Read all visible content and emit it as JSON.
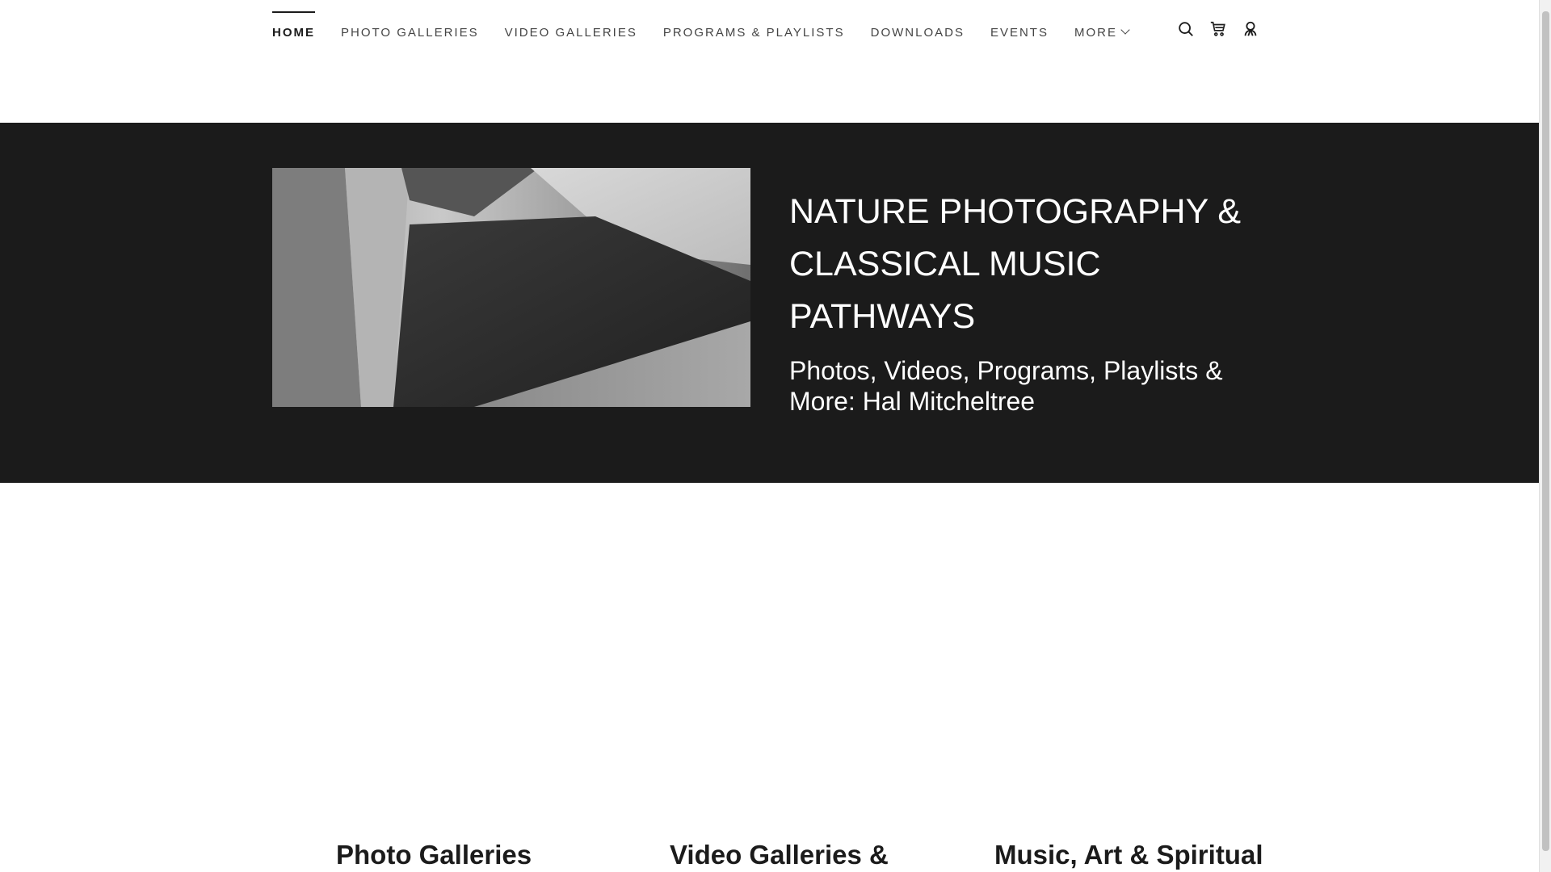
{
  "nav": {
    "items": [
      {
        "label": "HOME",
        "active": true
      },
      {
        "label": "PHOTO GALLERIES",
        "active": false
      },
      {
        "label": "VIDEO GALLERIES",
        "active": false
      },
      {
        "label": "PROGRAMS & PLAYLISTS",
        "active": false
      },
      {
        "label": "DOWNLOADS",
        "active": false
      },
      {
        "label": "EVENTS",
        "active": false
      },
      {
        "label": "MORE",
        "active": false
      }
    ],
    "icons": [
      "search-icon",
      "cart-icon",
      "account-icon"
    ]
  },
  "hero": {
    "title": "NATURE PHOTOGRAPHY & CLASSICAL MUSIC PATHWAYS",
    "subtitle": "Photos, Videos, Programs, Playlists & More: Hal Mitcheltree",
    "background_color": "#1b1b1b"
  },
  "sections": [
    {
      "title": "Photo Galleries"
    },
    {
      "title": "Video Galleries &"
    },
    {
      "title": "Music, Art & Spiritual"
    }
  ]
}
